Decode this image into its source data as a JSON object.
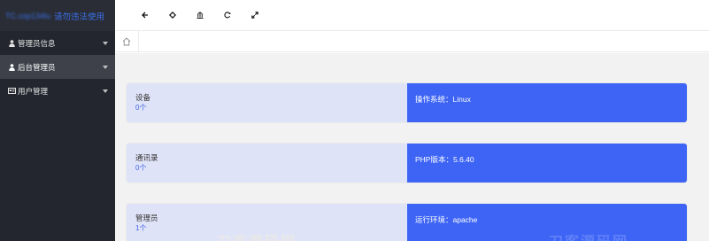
{
  "sidebar": {
    "brand_user": "TC.cop134lu",
    "brand_notice": "请勿违法使用",
    "items": [
      {
        "label": "管理员信息",
        "icon": "user-icon",
        "active": false
      },
      {
        "label": "后台管理员",
        "icon": "user-icon",
        "active": true
      },
      {
        "label": "用户管理",
        "icon": "id-card-icon",
        "active": false
      }
    ]
  },
  "header": {
    "toolbar": [
      "back-arrow-icon",
      "target-icon",
      "home-building-icon",
      "refresh-icon",
      "expand-icon"
    ]
  },
  "tabs": {
    "home_icon": "home-icon"
  },
  "cards": [
    {
      "title": "设备",
      "count": "0个",
      "info": "操作系统：Linux"
    },
    {
      "title": "通讯录",
      "count": "0个",
      "info": "PHP版本：5.6.40"
    },
    {
      "title": "管理员",
      "count": "1个",
      "info": "运行环境：apache"
    }
  ],
  "watermark": {
    "text_left": "刀客源码网",
    "text_right": "刀客源码网"
  },
  "colors": {
    "sidebar_bg": "#23262e",
    "sidebar_active": "#3e414a",
    "brand_blue": "#3a6fe8",
    "card_left_bg": "#dfe3f7",
    "card_right_bg": "#3d64f5",
    "count_blue": "#4068e6"
  }
}
